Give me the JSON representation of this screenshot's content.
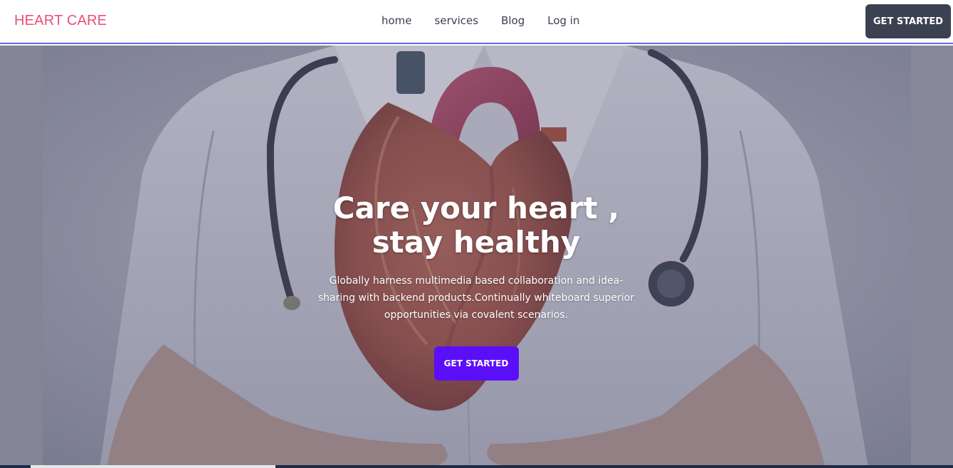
{
  "brand": {
    "name": "HEART CARE",
    "color": "#ec4e78"
  },
  "nav": {
    "links": [
      "home",
      "services",
      "Blog",
      "Log in"
    ],
    "cta_label": "GET STARTED",
    "cta_color": "#3a4150",
    "border_color": "#6366f1"
  },
  "hero": {
    "title_line1": "Care your heart ,",
    "title_line2": "stay healthy",
    "description": "Globally harness multimedia based collaboration and idea-sharing with backend products.Continually whiteboard superior opportunities via covalent scenarios.",
    "cta_label": "GET STARTED",
    "cta_color": "#5b0ef8",
    "background_image": "doctor-holding-anatomical-heart-photo"
  }
}
